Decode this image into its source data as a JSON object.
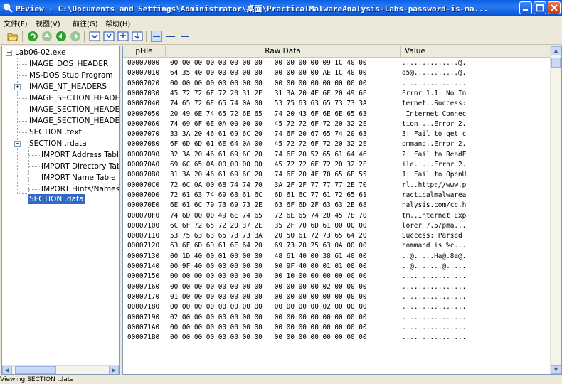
{
  "window": {
    "title": "PEview - C:\\Documents and Settings\\Administrator\\桌面\\PracticalMalwareAnalysis-Labs-password-is-ma..."
  },
  "menu": [
    "文件(F)",
    "视图(V)",
    "前往(G)",
    "帮助(H)"
  ],
  "tree": {
    "items": [
      {
        "label": "Lab06-02.exe"
      },
      {
        "label": "IMAGE_DOS_HEADER"
      },
      {
        "label": "MS-DOS Stub Program"
      },
      {
        "label": "IMAGE_NT_HEADERS"
      },
      {
        "label": "IMAGE_SECTION_HEADER .text"
      },
      {
        "label": "IMAGE_SECTION_HEADER .rdata"
      },
      {
        "label": "IMAGE_SECTION_HEADER .data"
      },
      {
        "label": "SECTION .text"
      },
      {
        "label": "SECTION .rdata"
      },
      {
        "label": "IMPORT Address Table"
      },
      {
        "label": "IMPORT Directory Table"
      },
      {
        "label": "IMPORT Name Table"
      },
      {
        "label": "IMPORT Hints/Names"
      },
      {
        "label": "SECTION .data"
      }
    ],
    "selected": "SECTION .data"
  },
  "table": {
    "headers": {
      "offset": "pFile",
      "raw": "Raw Data",
      "value": "Value"
    },
    "rows": [
      {
        "offset": "00007000",
        "raw": "00 00 00 00 00 00 00 00   00 00 00 00 09 1C 40 00",
        "value": "..............@."
      },
      {
        "offset": "00007010",
        "raw": "64 35 40 00 00 00 00 00   00 00 00 00 AE 1C 40 00",
        "value": "d5@...........@."
      },
      {
        "offset": "00007020",
        "raw": "00 00 00 00 00 00 00 00   00 00 00 00 00 00 00 00",
        "value": "................"
      },
      {
        "offset": "00007030",
        "raw": "45 72 72 6F 72 20 31 2E   31 3A 20 4E 6F 20 49 6E",
        "value": "Error 1.1: No In"
      },
      {
        "offset": "00007040",
        "raw": "74 65 72 6E 65 74 0A 00   53 75 63 63 65 73 73 3A",
        "value": "ternet..Success:"
      },
      {
        "offset": "00007050",
        "raw": "20 49 6E 74 65 72 6E 65   74 20 43 6F 6E 6E 65 63",
        "value": " Internet Connec"
      },
      {
        "offset": "00007060",
        "raw": "74 69 6F 6E 0A 00 00 00   45 72 72 6F 72 20 32 2E",
        "value": "tion....Error 2."
      },
      {
        "offset": "00007070",
        "raw": "33 3A 20 46 61 69 6C 20   74 6F 20 67 65 74 20 63",
        "value": "3: Fail to get c"
      },
      {
        "offset": "00007080",
        "raw": "6F 6D 6D 61 6E 64 0A 00   45 72 72 6F 72 20 32 2E",
        "value": "ommand..Error 2."
      },
      {
        "offset": "00007090",
        "raw": "32 3A 20 46 61 69 6C 20   74 6F 20 52 65 61 64 46",
        "value": "2: Fail to ReadF"
      },
      {
        "offset": "000070A0",
        "raw": "69 6C 65 0A 00 00 00 00   45 72 72 6F 72 20 32 2E",
        "value": "ile.....Error 2."
      },
      {
        "offset": "000070B0",
        "raw": "31 3A 20 46 61 69 6C 20   74 6F 20 4F 70 65 6E 55",
        "value": "1: Fail to OpenU"
      },
      {
        "offset": "000070C0",
        "raw": "72 6C 0A 00 68 74 74 70   3A 2F 2F 77 77 77 2E 70",
        "value": "rl..http://www.p"
      },
      {
        "offset": "000070D0",
        "raw": "72 61 63 74 69 63 61 6C   6D 61 6C 77 61 72 65 61",
        "value": "racticalmalwarea"
      },
      {
        "offset": "000070E0",
        "raw": "6E 61 6C 79 73 69 73 2E   63 6F 6D 2F 63 63 2E 68",
        "value": "nalysis.com/cc.h"
      },
      {
        "offset": "000070F0",
        "raw": "74 6D 00 00 49 6E 74 65   72 6E 65 74 20 45 78 70",
        "value": "tm..Internet Exp"
      },
      {
        "offset": "00007100",
        "raw": "6C 6F 72 65 72 20 37 2E   35 2F 70 6D 61 00 00 00",
        "value": "lorer 7.5/pma..."
      },
      {
        "offset": "00007110",
        "raw": "53 75 63 63 65 73 73 3A   20 50 61 72 73 65 64 20",
        "value": "Success: Parsed "
      },
      {
        "offset": "00007120",
        "raw": "63 6F 6D 6D 61 6E 64 20   69 73 20 25 63 0A 00 00",
        "value": "command is %c..."
      },
      {
        "offset": "00007130",
        "raw": "00 1D 40 00 01 00 00 00   48 61 40 00 38 61 40 00",
        "value": "..@.....Ha@.8a@."
      },
      {
        "offset": "00007140",
        "raw": "00 9F 40 00 00 00 00 00   00 9F 40 00 01 01 00 00",
        "value": "..@.......@....."
      },
      {
        "offset": "00007150",
        "raw": "00 00 00 00 00 00 00 00   00 10 00 00 00 00 00 00",
        "value": "................"
      },
      {
        "offset": "00007160",
        "raw": "00 00 00 00 00 00 00 00   00 00 00 00 02 00 00 00",
        "value": "................"
      },
      {
        "offset": "00007170",
        "raw": "01 00 00 00 00 00 00 00   00 00 00 00 00 00 00 00",
        "value": "................"
      },
      {
        "offset": "00007180",
        "raw": "00 00 00 00 00 00 00 00   00 00 00 00 02 00 00 00",
        "value": "................"
      },
      {
        "offset": "00007190",
        "raw": "02 00 00 00 00 00 00 00   00 00 00 00 00 00 00 00",
        "value": "................"
      },
      {
        "offset": "000071A0",
        "raw": "00 00 00 00 00 00 00 00   00 00 00 00 00 00 00 00",
        "value": "................"
      },
      {
        "offset": "000071B0",
        "raw": "00 00 00 00 00 00 00 00   00 00 00 00 00 00 00 00",
        "value": "................"
      }
    ]
  },
  "status": {
    "text": "Viewing SECTION .data"
  },
  "colors": {
    "selection": "#316ac5",
    "titlebar": "#0a5ee6",
    "panel_border": "#7f9db9"
  }
}
